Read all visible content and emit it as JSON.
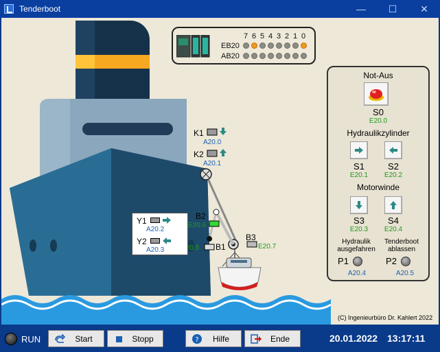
{
  "window": {
    "title": "Tenderboot",
    "minimize": "—",
    "maximize": "☐",
    "close": "✕"
  },
  "plc": {
    "bits": [
      "7",
      "6",
      "5",
      "4",
      "3",
      "2",
      "1",
      "0"
    ],
    "eb_label": "EB20",
    "ab_label": "AB20",
    "eb_leds": [
      0,
      1,
      0,
      0,
      0,
      0,
      0,
      1
    ],
    "ab_leds": [
      0,
      0,
      0,
      0,
      0,
      0,
      0,
      0
    ],
    "led_on_color": "#f29a1f",
    "led_off_color": "#8d8d86"
  },
  "scene": {
    "k1": {
      "label": "K1",
      "addr": "A20.0"
    },
    "k2": {
      "label": "K2",
      "addr": "A20.1"
    },
    "b1": {
      "label": "B1",
      "addr": "E20.5"
    },
    "b2": {
      "label": "B2",
      "addr": "E20.6"
    },
    "b3": {
      "label": "B3",
      "addr": "E20.7"
    },
    "y1": {
      "label": "Y1",
      "addr": "A20.2"
    },
    "y2": {
      "label": "Y2",
      "addr": "A20.3"
    },
    "copyright": "(C) Ingenieurbüro Dr. Kahlert 2022"
  },
  "panel": {
    "notaus_title": "Not-Aus",
    "s0": {
      "label": "S0",
      "addr": "E20.0"
    },
    "hydraulik_title": "Hydraulikzylinder",
    "s1": {
      "label": "S1",
      "addr": "E20.1"
    },
    "s2": {
      "label": "S2",
      "addr": "E20.2"
    },
    "motor_title": "Motorwinde",
    "s3": {
      "label": "S3",
      "addr": "E20.3"
    },
    "s4": {
      "label": "S4",
      "addr": "E20.4"
    },
    "p1_caption": "Hydraulik ausgefahren",
    "p2_caption": "Tenderboot ablassen",
    "p1": {
      "label": "P1",
      "addr": "A20.4"
    },
    "p2": {
      "label": "P2",
      "addr": "A20.5"
    }
  },
  "statusbar": {
    "run_label": "RUN",
    "start": "Start",
    "stopp": "Stopp",
    "hilfe": "Hilfe",
    "ende": "Ende",
    "date": "20.01.2022",
    "time": "13:17:11"
  }
}
